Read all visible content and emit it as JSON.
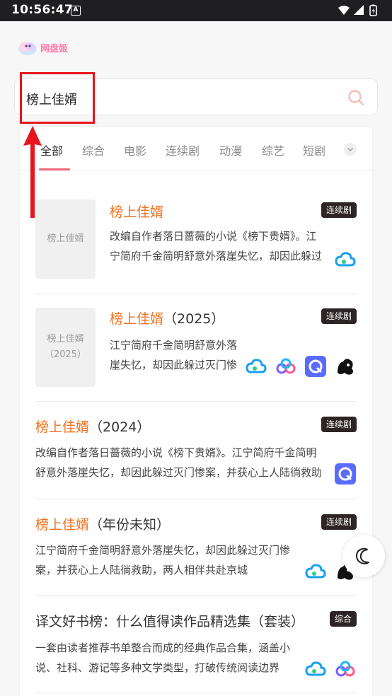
{
  "status": {
    "time": "10:56:47",
    "notif": "A"
  },
  "app": {
    "logo_text": "网盘姬"
  },
  "search": {
    "query": "榜上佳婿"
  },
  "tabs": [
    "全部",
    "综合",
    "电影",
    "连续剧",
    "动漫",
    "综艺",
    "短剧"
  ],
  "results": [
    {
      "title_hl": "榜上佳婿",
      "title_rest": "",
      "badge": "连续剧",
      "poster": "榜上佳婿",
      "desc": "改编自作者落日蔷薇的小说《榜下贵婿》。江宁简府千金简明舒意外落崖失忆，却因此躲过灭门惨案",
      "icons": [
        "baidu-cloud-icon"
      ]
    },
    {
      "title_hl": "榜上佳婿",
      "title_rest": "（2025）",
      "badge": "连续剧",
      "poster": "榜上佳婿\n（2025）",
      "desc": "江宁简府千金简明舒意外落崖失忆，却因此躲过灭门惨案",
      "icons": [
        "baidu-cloud-icon",
        "aliyun-drive-icon",
        "quark-icon",
        "uc-icon"
      ]
    },
    {
      "title_hl": "榜上佳婿",
      "title_rest": "（2024）",
      "badge": "连续剧",
      "desc": "改编自作者落日蔷薇的小说《榜下贵婿》。江宁简府千金简明舒意外落崖失忆，却因此躲过灭门惨案，并获心上人陆徜救助",
      "icons": [
        "quark-icon"
      ]
    },
    {
      "title_hl": "榜上佳婿",
      "title_rest": "（年份未知）",
      "badge": "连续剧",
      "desc": "江宁简府千金简明舒意外落崖失忆，却因此躲过灭门惨案，并获心上人陆徜救助，两人相伴共赴京城",
      "icons": [
        "baidu-cloud-icon",
        "uc-icon"
      ]
    },
    {
      "title_hl": "",
      "title_rest": "译文好书榜：什么值得读作品精选集（套装）",
      "badge": "综合",
      "desc": "一套由读者推荐书单整合而成的经典作品合集，涵盖小说、社科、游记等多种文学类型，打破传统阅读边界",
      "icons": [
        "baidu-cloud-icon",
        "aliyun-drive-icon"
      ]
    }
  ],
  "colors": {
    "accent": "#f07020",
    "badge_bg": "#2d2426",
    "annotation": "#e8141b"
  }
}
